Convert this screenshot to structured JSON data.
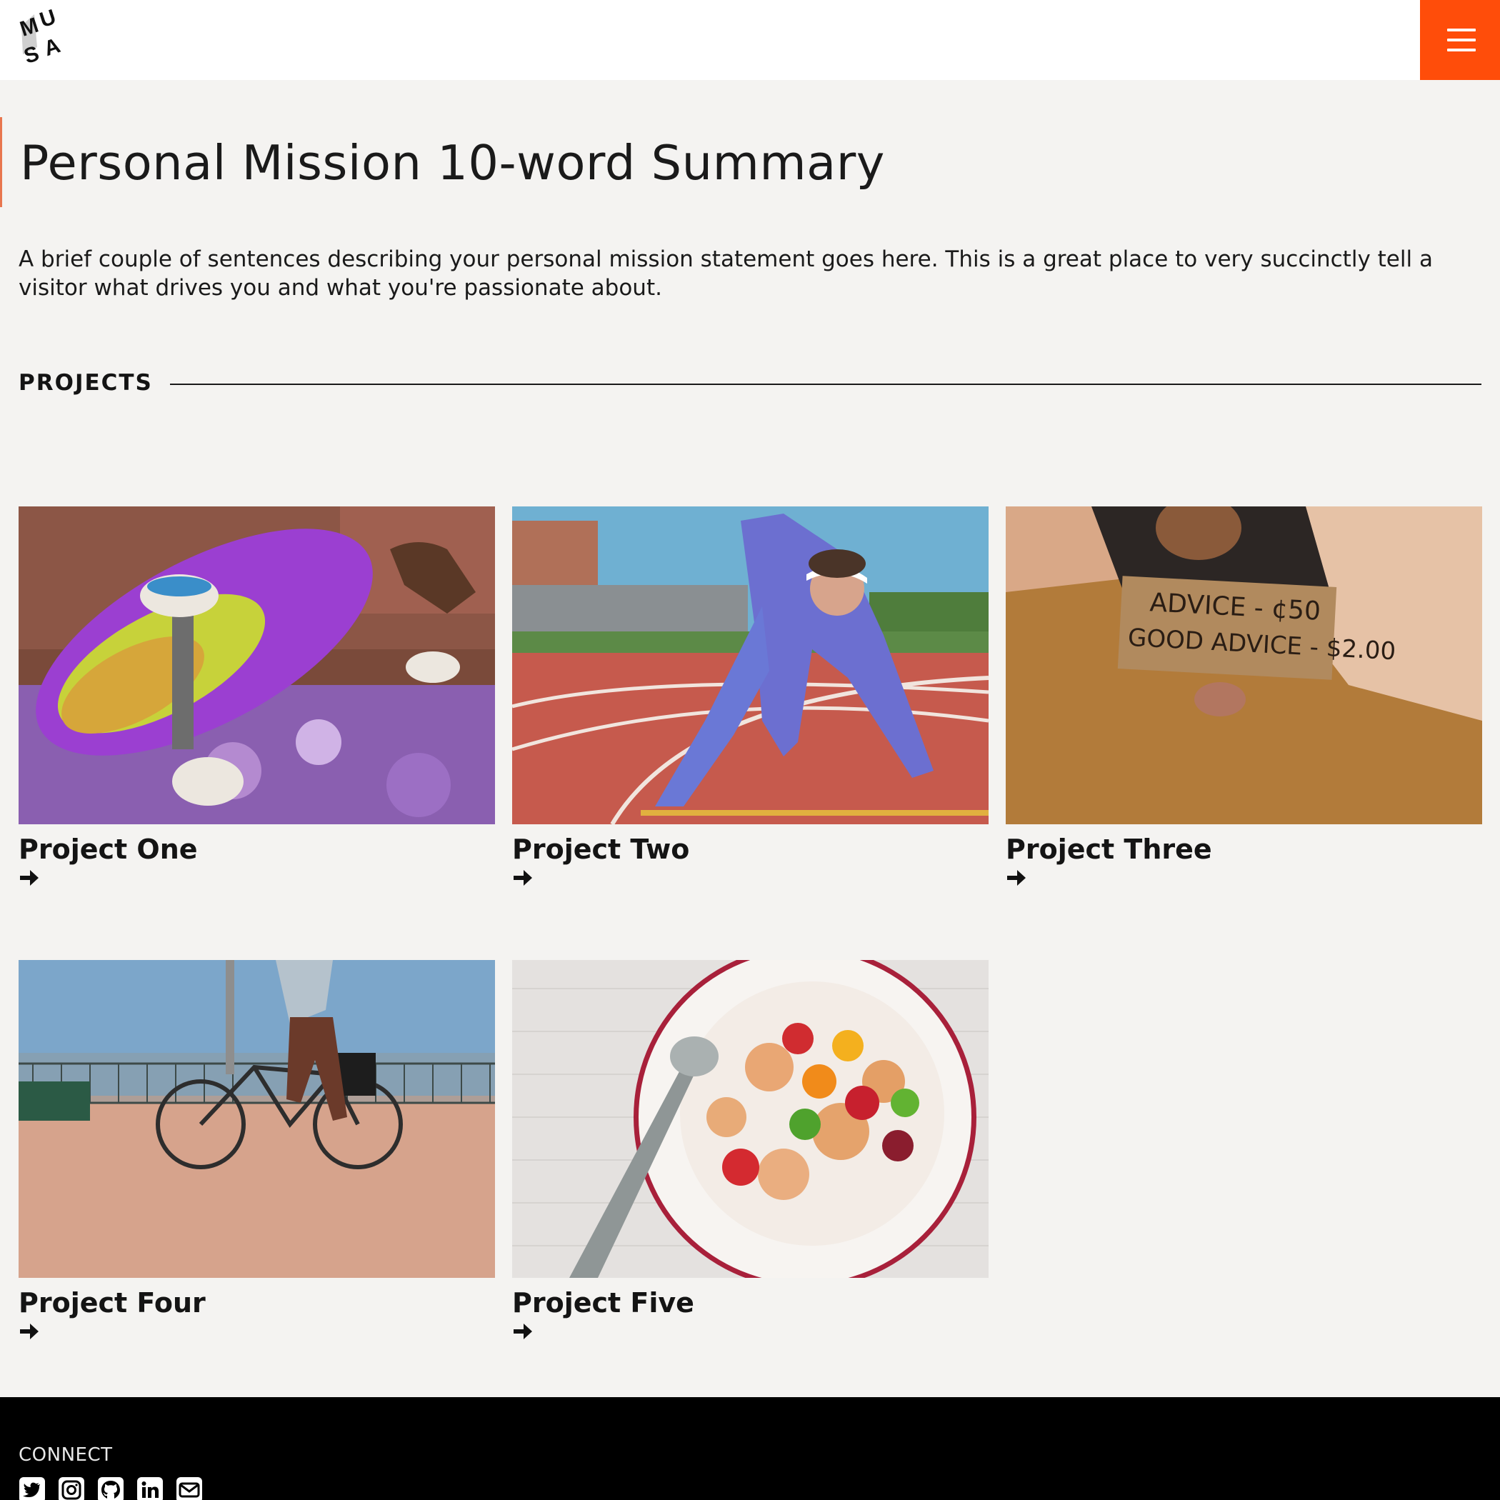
{
  "header": {
    "logo_text": "MUSA",
    "menu_icon": "hamburger-menu-icon",
    "menu_color": "#ff4d0a"
  },
  "hero": {
    "title": "Personal Mission 10-word Summary",
    "description": "A brief couple of sentences describing your personal mission statement goes here. This is a great place to very succinctly tell a visitor what drives you and what you're passionate about."
  },
  "projects_section": {
    "label": "PROJECTS",
    "items": [
      {
        "title": "Project One",
        "image": "skateboard-photo"
      },
      {
        "title": "Project Two",
        "image": "runner-on-track-photo"
      },
      {
        "title": "Project Three",
        "image": "advice-sign-photo",
        "sign_line1": "ADVICE - ¢50",
        "sign_line2": "GOOD ADVICE - $2.00"
      },
      {
        "title": "Project Four",
        "image": "cyclist-photo"
      },
      {
        "title": "Project Five",
        "image": "cereal-gummy-bears-photo"
      }
    ]
  },
  "footer": {
    "connect_label": "CONNECT",
    "social_icons": [
      "twitter-icon",
      "instagram-icon",
      "github-icon",
      "linkedin-icon",
      "email-icon"
    ]
  }
}
